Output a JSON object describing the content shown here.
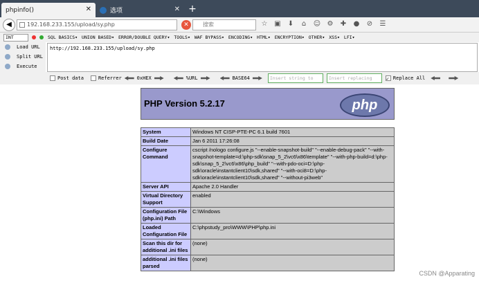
{
  "tabs": [
    {
      "title": "phpinfo()"
    },
    {
      "title": "选项"
    }
  ],
  "navbar": {
    "url": "192.168.233.155/upload/sy.php",
    "search_placeholder": "搜索"
  },
  "hackbar": {
    "type_select": "INT",
    "menu": [
      "SQL BASICS▾",
      "UNION BASED▾",
      "ERROR/DOUBLE QUERY▾",
      "TOOLS▾",
      "WAF BYPASS▾",
      "ENCODING▾",
      "HTML▾",
      "ENCRYPTION▾",
      "OTHER▾",
      "XSS▾",
      "LFI▾"
    ],
    "load_url": "Load URL",
    "split_url": "Split URL",
    "execute": "Execute",
    "url_text": "http://192.168.233.155/upload/sy.php",
    "post_data": "Post data",
    "referrer": "Referrer",
    "hex": "0xHEX",
    "url_enc": "%URL",
    "base64": "BASE64",
    "find_placeholder": "Insert string to repl",
    "replace_placeholder": "Insert replacing strin",
    "replace_all": "Replace All"
  },
  "php": {
    "version": "PHP Version 5.2.17",
    "logo": "php",
    "rows": [
      {
        "key": "System",
        "value": "Windows NT CISP-PTE-PC 6.1 build 7601"
      },
      {
        "key": "Build Date",
        "value": "Jan 6 2011 17:26:08"
      },
      {
        "key": "Configure Command",
        "value": "cscript /nologo configure.js \"--enable-snapshot-build\" \"--enable-debug-pack\" \"--with-snapshot-template=d:\\php-sdk\\snap_5_2\\vc6\\x86\\template\" \"--with-php-build=d:\\php-sdk\\snap_5_2\\vc6\\x86\\php_build\" \"--with-pdo-oci=D:\\php-sdk\\oracle\\instantclient10\\sdk,shared\" \"--with-oci8=D:\\php-sdk\\oracle\\instantclient10\\sdk,shared\" \"--without-pi3web\""
      },
      {
        "key": "Server API",
        "value": "Apache 2.0 Handler"
      },
      {
        "key": "Virtual Directory Support",
        "value": "enabled"
      },
      {
        "key": "Configuration File (php.ini) Path",
        "value": "C:\\Windows"
      },
      {
        "key": "Loaded Configuration File",
        "value": "C:\\phpstudy_pro\\WWW\\PHP\\php.ini"
      },
      {
        "key": "Scan this dir for additional .ini files",
        "value": "(none)"
      },
      {
        "key": "additional .ini files parsed",
        "value": "(none)"
      }
    ]
  },
  "watermark": "CSDN @Apparating"
}
